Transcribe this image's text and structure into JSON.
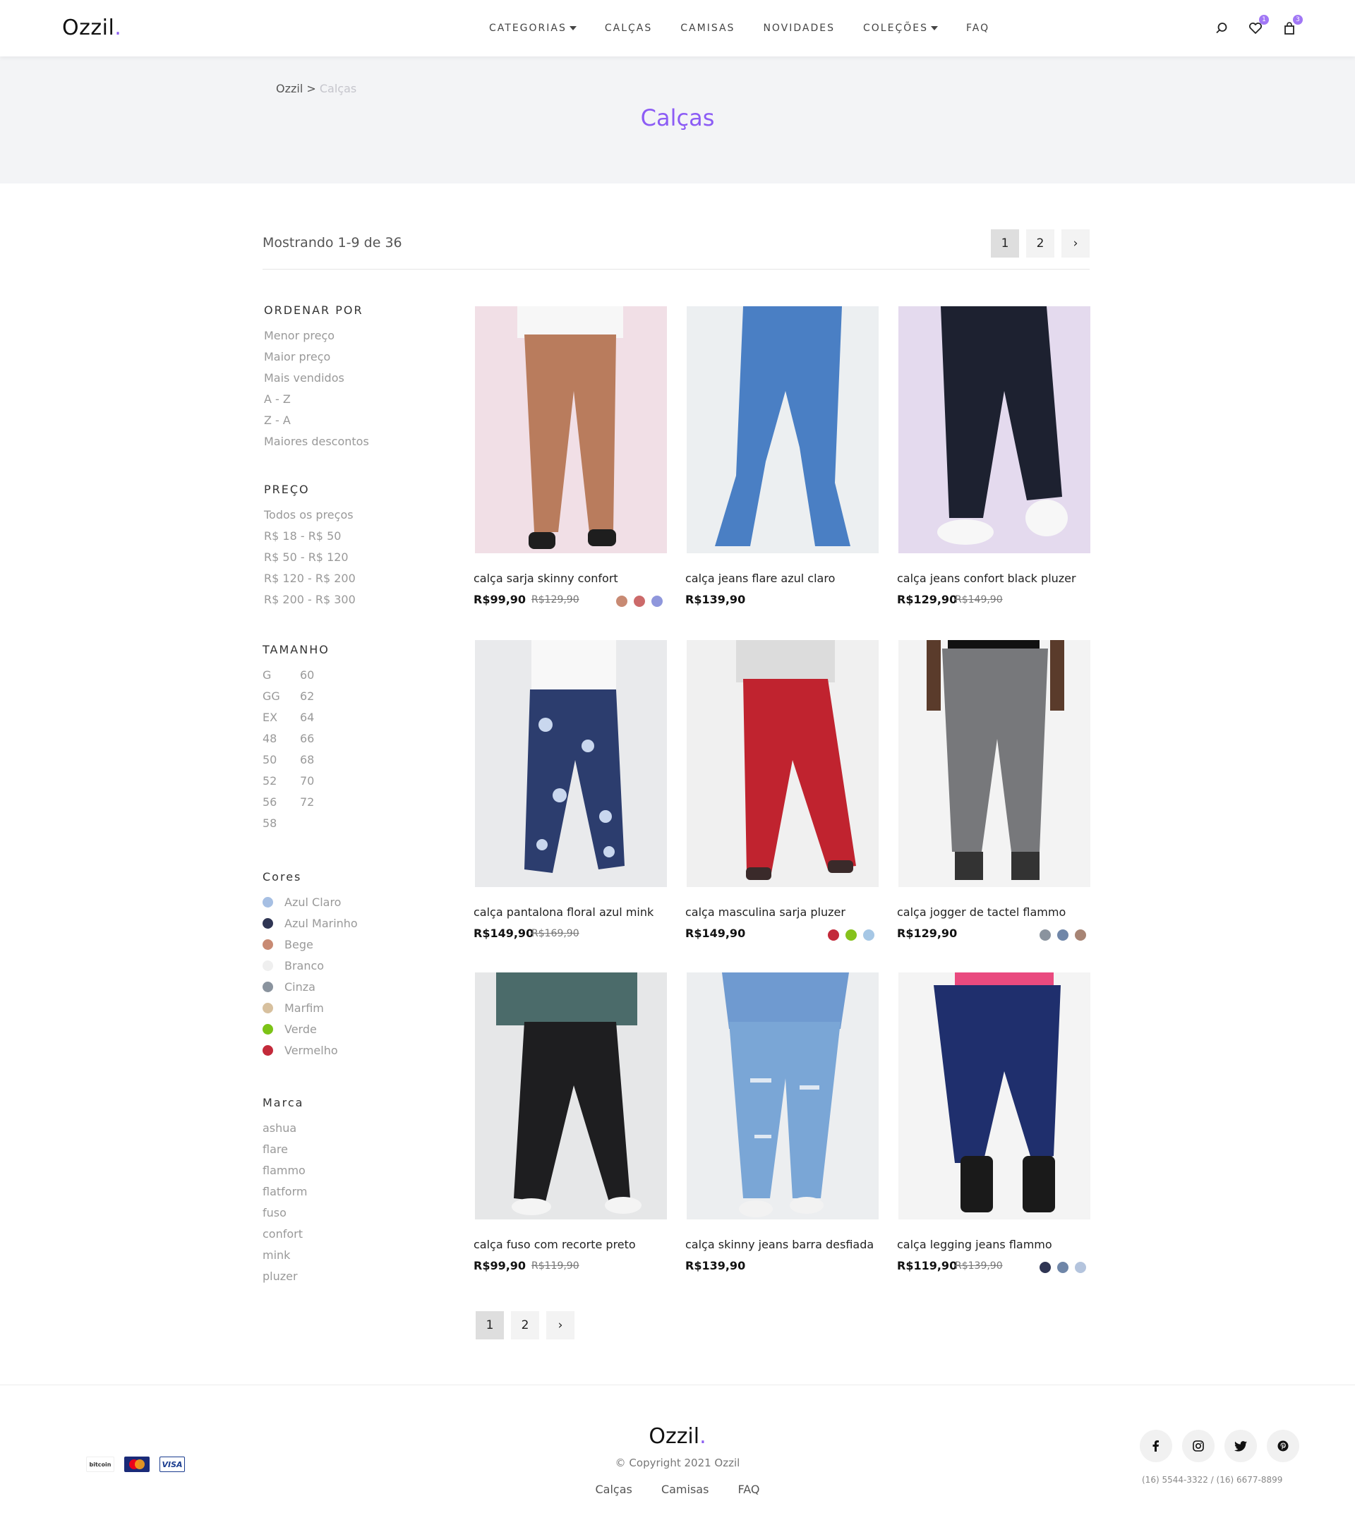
{
  "header": {
    "logo": "Ozzil",
    "logo_dot": ".",
    "nav": [
      {
        "label": "CATEGORIAS",
        "dropdown": true
      },
      {
        "label": "CALÇAS",
        "dropdown": false
      },
      {
        "label": "CAMISAS",
        "dropdown": false
      },
      {
        "label": "NOVIDADES",
        "dropdown": false
      },
      {
        "label": "COLEÇÕES",
        "dropdown": true
      },
      {
        "label": "FAQ",
        "dropdown": false
      }
    ],
    "wishlist_count": "1",
    "cart_count": "3",
    "accent_color": "#8c5cf5"
  },
  "banner": {
    "breadcrumb_home": "Ozzil",
    "breadcrumb_sep": ">",
    "breadcrumb_current": "Calças",
    "title": "Calças"
  },
  "toolbar": {
    "result_text": "Mostrando 1-9 de 36",
    "pages": [
      "1",
      "2",
      "›"
    ],
    "active_page": "1"
  },
  "sidebar": {
    "sort": {
      "title": "ORDENAR POR",
      "options": [
        "Menor preço",
        "Maior preço",
        "Mais vendidos",
        "A - Z",
        "Z - A",
        "Maiores descontos"
      ]
    },
    "price": {
      "title": "PREÇO",
      "options": [
        "Todos os preços",
        "R$ 18 - R$ 50",
        "R$ 50 - R$ 120",
        "R$ 120 - R$ 200",
        "R$ 200 - R$ 300"
      ]
    },
    "size": {
      "title": "TAMANHO",
      "col1": [
        "G",
        "GG",
        "EX",
        "48",
        "50",
        "52",
        "56",
        "58"
      ],
      "col2": [
        "60",
        "62",
        "64",
        "66",
        "68",
        "70",
        "72"
      ]
    },
    "colors": {
      "title": "Cores",
      "options": [
        {
          "label": "Azul Claro",
          "hex": "#a6bfe3"
        },
        {
          "label": "Azul Marinho",
          "hex": "#2f3553"
        },
        {
          "label": "Bege",
          "hex": "#c88a73"
        },
        {
          "label": "Branco",
          "hex": "#efefef"
        },
        {
          "label": "Cinza",
          "hex": "#8a939e"
        },
        {
          "label": "Marfim",
          "hex": "#d7c09e"
        },
        {
          "label": "Verde",
          "hex": "#7cc316"
        },
        {
          "label": "Vermelho",
          "hex": "#c32a3a"
        }
      ]
    },
    "brand": {
      "title": "Marca",
      "options": [
        "ashua",
        "flare",
        "flammo",
        "flatform",
        "fuso",
        "confort",
        "mink",
        "pluzer"
      ]
    }
  },
  "products": [
    {
      "name": "calça sarja skinny confort",
      "price": "R$99,90",
      "old_price": "R$129,90",
      "colors": [
        "#c88a73",
        "#cc6a6a",
        "#8f97dc"
      ],
      "img": "pants-beige"
    },
    {
      "name": "calça jeans flare azul claro",
      "price": "R$139,90",
      "old_price": "",
      "colors": [],
      "img": "jeans-light-blue"
    },
    {
      "name": "calça jeans confort black pluzer",
      "price": "R$129,90",
      "old_price": "R$149,90",
      "colors": [],
      "img": "jeans-black"
    },
    {
      "name": "calça pantalona floral azul mink",
      "price": "R$149,90",
      "old_price": "R$169,90",
      "colors": [],
      "img": "pants-floral"
    },
    {
      "name": "calça masculina sarja pluzer",
      "price": "R$149,90",
      "old_price": "",
      "colors": [
        "#c32a3a",
        "#86c21c",
        "#a6c7e5"
      ],
      "img": "pants-red"
    },
    {
      "name": "calça jogger de tactel flammo",
      "price": "R$129,90",
      "old_price": "",
      "colors": [
        "#8a939e",
        "#6f86a8",
        "#a78474"
      ],
      "img": "jogger-grey"
    },
    {
      "name": "calça fuso com recorte preto",
      "price": "R$99,90",
      "old_price": "R$119,90",
      "colors": [],
      "img": "leggings-black"
    },
    {
      "name": "calça skinny jeans barra desfiada",
      "price": "R$139,90",
      "old_price": "",
      "colors": [],
      "img": "jeans-ripped"
    },
    {
      "name": "calça legging jeans flammo",
      "price": "R$119,90",
      "old_price": "R$139,90",
      "colors": [
        "#2f3553",
        "#6f86a8",
        "#b4c4dd"
      ],
      "img": "legging-navy"
    }
  ],
  "bottom_pager": {
    "pages": [
      "1",
      "2",
      "›"
    ],
    "active_page": "1"
  },
  "footer": {
    "logo": "Ozzil",
    "logo_dot": ".",
    "copyright": "© Copyright 2021 Ozzil",
    "links": [
      "Calças",
      "Camisas",
      "FAQ"
    ],
    "phones": "(16) 5544-3322  / (16) 6677-8899",
    "payment_bitcoin": "bitcoin",
    "payment_mastercard": "MasterCard",
    "payment_visa": "VISA",
    "social_icons": [
      "facebook-icon",
      "instagram-icon",
      "twitter-icon",
      "pinterest-icon"
    ]
  }
}
